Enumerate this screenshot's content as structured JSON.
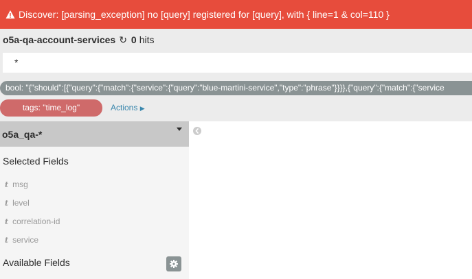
{
  "error": {
    "message": "Discover: [parsing_exception] no [query] registered for [query], with { line=1 & col=110 }",
    "color": "#e74c3c"
  },
  "header": {
    "index_pattern": "o5a-qa-account-services",
    "hits_count": "0",
    "hits_label": "hits"
  },
  "search": {
    "value": "*"
  },
  "filter": {
    "text": "bool: \"{\"should\":[{\"query\":{\"match\":{\"service\":{\"query\":\"blue-martini-service\",\"type\":\"phrase\"}}}},{\"query\":{\"match\":{\"service"
  },
  "tags": {
    "label": "tags: \"time_log\"",
    "actions_label": "Actions"
  },
  "sidebar": {
    "index_name": "o5a_qa-*",
    "selected_fields_title": "Selected Fields",
    "selected_fields": [
      {
        "type": "t",
        "name": "msg"
      },
      {
        "type": "t",
        "name": "level"
      },
      {
        "type": "t",
        "name": "correlation-id"
      },
      {
        "type": "t",
        "name": "service"
      }
    ],
    "available_fields_title": "Available Fields"
  },
  "icons": {
    "warning": "warning-icon",
    "reload": "reload-icon",
    "caret": "chevron-down-icon",
    "actions": "caret-right-icon",
    "gear": "gear-icon",
    "collapse": "chevron-left-icon"
  }
}
